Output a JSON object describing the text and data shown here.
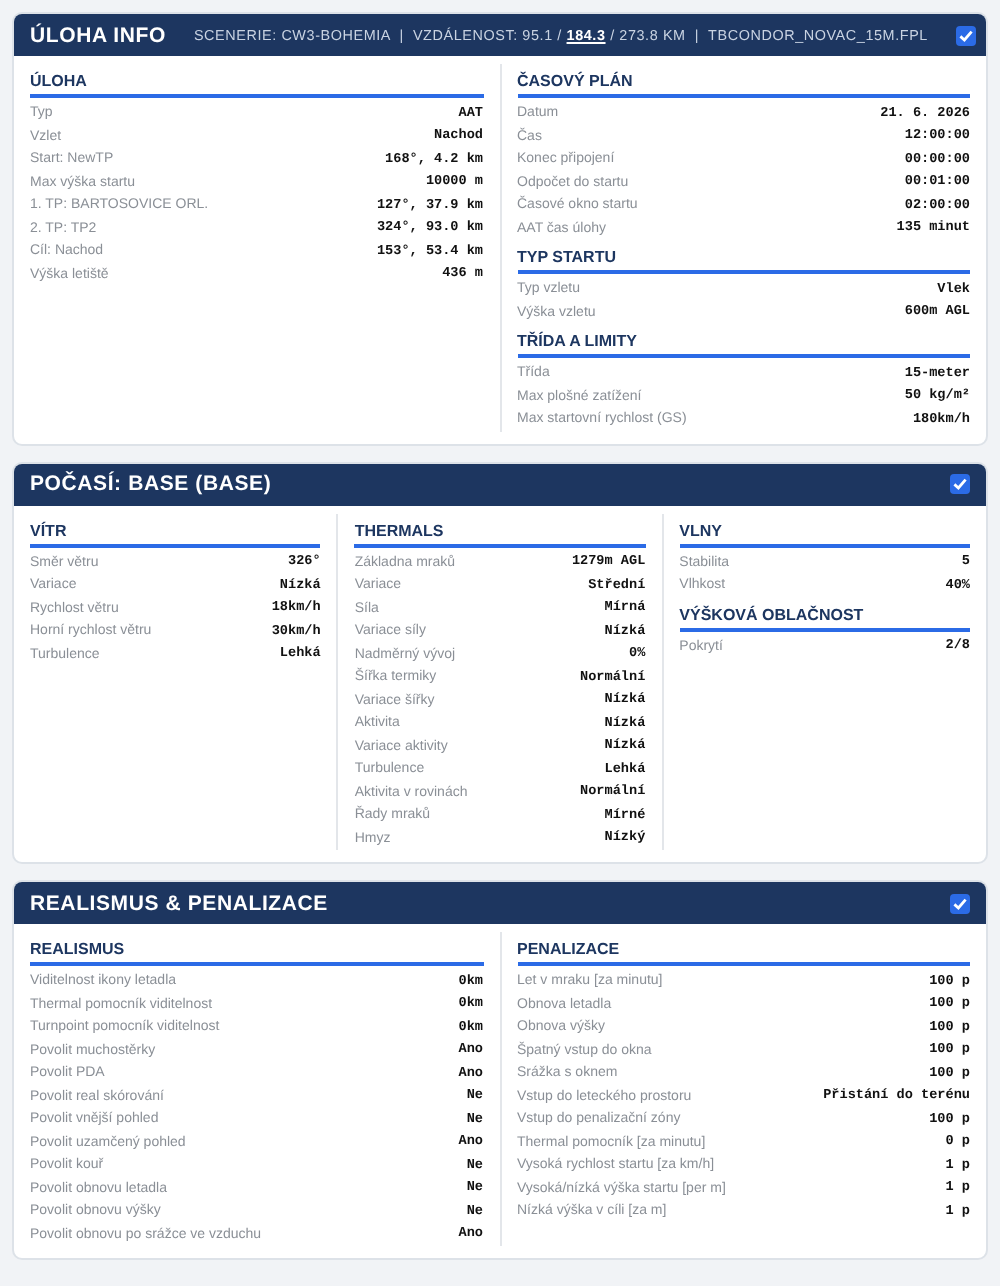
{
  "panels": [
    {
      "title": "ÚLOHA INFO",
      "subtitle": "SCENERIE: CW3-BOHEMIA  |  VZDÁLENOST: 95.1 / **184.3** / 273.8 KM  |  TBCONDOR_NOVAC_15M.FPL",
      "checked": true,
      "columns": [
        [
          {
            "title": "ÚLOHA",
            "rows": [
              {
                "label": "Typ",
                "value": "AAT"
              },
              {
                "label": "Vzlet",
                "value": "Nachod"
              },
              {
                "label": "Start: NewTP",
                "value": "168°, 4.2 km"
              },
              {
                "label": "Max výška startu",
                "value": "10000 m"
              },
              {
                "label": "1. TP: BARTOSOVICE ORL.",
                "value": "127°, 37.9 km"
              },
              {
                "label": "2. TP: TP2",
                "value": "324°, 93.0 km"
              },
              {
                "label": "Cíl: Nachod",
                "value": "153°, 53.4 km"
              },
              {
                "label": "Výška letiště",
                "value": "436 m"
              }
            ]
          }
        ],
        [
          {
            "title": "ČASOVÝ PLÁN",
            "rows": [
              {
                "label": "Datum",
                "value": "21. 6. 2026"
              },
              {
                "label": "Čas",
                "value": "12:00:00"
              },
              {
                "label": "Konec připojení",
                "value": "00:00:00"
              },
              {
                "label": "Odpočet do startu",
                "value": "00:01:00"
              },
              {
                "label": "Časové okno startu",
                "value": "02:00:00"
              },
              {
                "label": "AAT čas úlohy",
                "value": "135 minut"
              }
            ]
          },
          {
            "title": "TYP STARTU",
            "rows": [
              {
                "label": "Typ vzletu",
                "value": "Vlek"
              },
              {
                "label": "Výška vzletu",
                "value": "600m AGL"
              }
            ]
          },
          {
            "title": "TŘÍDA A LIMITY",
            "rows": [
              {
                "label": "Třída",
                "value": "15-meter"
              },
              {
                "label": "Max plošné zatížení",
                "value": "50 kg/m²"
              },
              {
                "label": "Max startovní rychlost (GS)",
                "value": "180km/h"
              }
            ]
          }
        ]
      ]
    },
    {
      "title": "POČASÍ: BASE (BASE)",
      "checked": true,
      "columns": [
        [
          {
            "title": "VÍTR",
            "rows": [
              {
                "label": "Směr větru",
                "value": "326°"
              },
              {
                "label": "Variace",
                "value": "Nízká"
              },
              {
                "label": "Rychlost větru",
                "value": "18km/h"
              },
              {
                "label": "Horní rychlost větru",
                "value": "30km/h"
              },
              {
                "label": "Turbulence",
                "value": "Lehká"
              }
            ]
          }
        ],
        [
          {
            "title": "THERMALS",
            "rows": [
              {
                "label": "Základna mraků",
                "value": "1279m AGL"
              },
              {
                "label": "Variace",
                "value": "Střední"
              },
              {
                "label": "Síla",
                "value": "Mírná"
              },
              {
                "label": "Variace síly",
                "value": "Nízká"
              },
              {
                "label": "Nadměrný vývoj",
                "value": "0%"
              },
              {
                "label": "Šířka termiky",
                "value": "Normální"
              },
              {
                "label": "Variace šířky",
                "value": "Nízká"
              },
              {
                "label": "Aktivita",
                "value": "Nízká"
              },
              {
                "label": "Variace aktivity",
                "value": "Nízká"
              },
              {
                "label": "Turbulence",
                "value": "Lehká"
              },
              {
                "label": "Aktivita v rovinách",
                "value": "Normální"
              },
              {
                "label": "Řady mraků",
                "value": "Mírné"
              },
              {
                "label": "Hmyz",
                "value": "Nízký"
              }
            ]
          }
        ],
        [
          {
            "title": "VLNY",
            "rows": [
              {
                "label": "Stabilita",
                "value": "5"
              },
              {
                "label": "Vlhkost",
                "value": "40%"
              }
            ]
          },
          {
            "title": "VÝŠKOVÁ OBLAČNOST",
            "rows": [
              {
                "label": "Pokrytí",
                "value": "2/8"
              }
            ]
          }
        ]
      ]
    },
    {
      "title": "REALISMUS & PENALIZACE",
      "checked": true,
      "columns": [
        [
          {
            "title": "REALISMUS",
            "rows": [
              {
                "label": "Viditelnost ikony letadla",
                "value": "0km"
              },
              {
                "label": "Thermal pomocník viditelnost",
                "value": "0km"
              },
              {
                "label": "Turnpoint pomocník viditelnost",
                "value": "0km"
              },
              {
                "label": "Povolit muchostěrky",
                "value": "Ano"
              },
              {
                "label": "Povolit PDA",
                "value": "Ano"
              },
              {
                "label": "Povolit real skórování",
                "value": "Ne"
              },
              {
                "label": "Povolit vnější pohled",
                "value": "Ne"
              },
              {
                "label": "Povolit uzamčený pohled",
                "value": "Ano"
              },
              {
                "label": "Povolit kouř",
                "value": "Ne"
              },
              {
                "label": "Povolit obnovu letadla",
                "value": "Ne"
              },
              {
                "label": "Povolit obnovu výšky",
                "value": "Ne"
              },
              {
                "label": "Povolit obnovu po srážce ve vzduchu",
                "value": "Ano"
              }
            ]
          }
        ],
        [
          {
            "title": "PENALIZACE",
            "rows": [
              {
                "label": "Let v mraku [za minutu]",
                "value": "100 p"
              },
              {
                "label": "Obnova letadla",
                "value": "100 p"
              },
              {
                "label": "Obnova výšky",
                "value": "100 p"
              },
              {
                "label": "Špatný vstup do okna",
                "value": "100 p"
              },
              {
                "label": "Srážka s oknem",
                "value": "100 p"
              },
              {
                "label": "Vstup do leteckého prostoru",
                "value": "Přistání do terénu"
              },
              {
                "label": "Vstup do penalizační zóny",
                "value": "100 p"
              },
              {
                "label": "Thermal pomocník [za minutu]",
                "value": "0 p"
              },
              {
                "label": "Vysoká rychlost startu [za km/h]",
                "value": "1 p"
              },
              {
                "label": "Vysoká/nízká výška startu [per m]",
                "value": "1 p"
              },
              {
                "label": "Nízká výška v cíli [za m]",
                "value": "1 p"
              }
            ]
          }
        ]
      ]
    }
  ]
}
